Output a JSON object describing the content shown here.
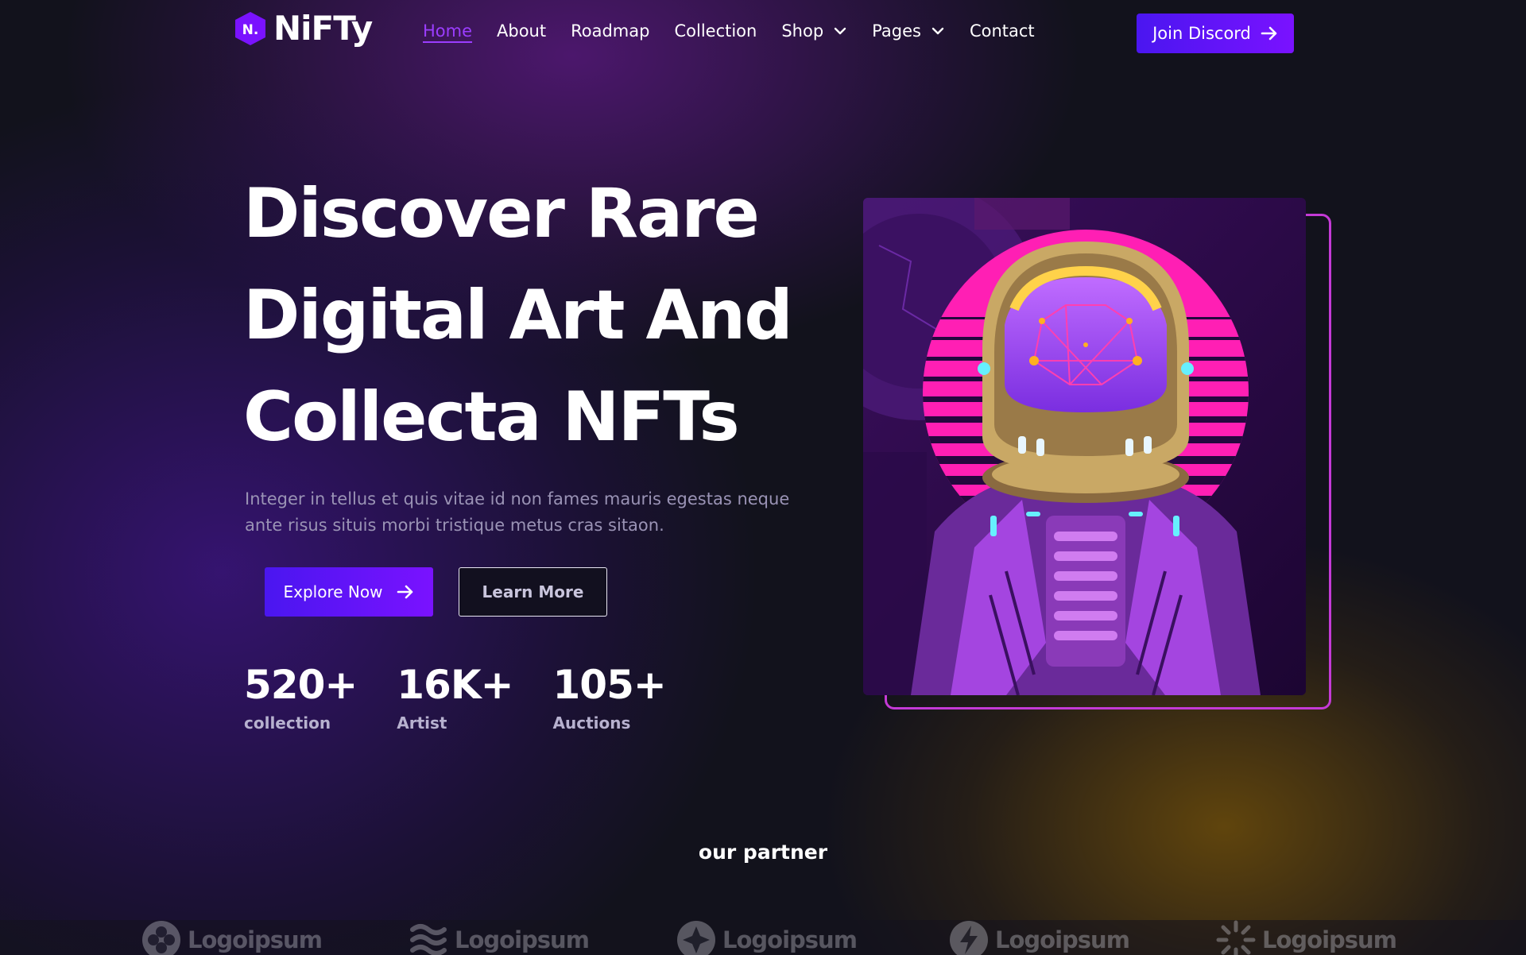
{
  "brand": {
    "logo_mark": "N.",
    "name": "NiFTy"
  },
  "nav": {
    "items": [
      {
        "label": "Home",
        "active": true
      },
      {
        "label": "About"
      },
      {
        "label": "Roadmap"
      },
      {
        "label": "Collection"
      },
      {
        "label": "Shop",
        "dropdown": true
      },
      {
        "label": "Pages",
        "dropdown": true
      },
      {
        "label": "Contact"
      }
    ],
    "cta_label": "Join Discord"
  },
  "hero": {
    "title_line1": "Discover Rare",
    "title_line2": "Digital Art And",
    "title_line3_prefix": "Collecta ",
    "title_highlight": "NFTs",
    "description": "Integer in tellus et quis vitae id non fames mauris egestas neque ante risus situis morbi tristique metus cras sitaon.",
    "primary_button": "Explore Now",
    "secondary_button": "Learn More"
  },
  "stats": [
    {
      "value": "520+",
      "label": "collection"
    },
    {
      "value": "16K+",
      "label": "Artist"
    },
    {
      "value": "105+",
      "label": "Auctions"
    }
  ],
  "partners": {
    "title": "our partner",
    "logos": [
      {
        "name": "Logoipsum",
        "icon": "clover-icon"
      },
      {
        "name": "Logoipsum",
        "icon": "waves-icon"
      },
      {
        "name": "Logoipsum",
        "icon": "star-badge-icon"
      },
      {
        "name": "Logoipsum",
        "icon": "bolt-icon"
      },
      {
        "name": "Logoipsum",
        "icon": "sunburst-icon"
      }
    ]
  },
  "colors": {
    "accent": "#6a14ff",
    "highlight": "#f5a623",
    "frame": "#c43ad6",
    "background": "#12121c"
  }
}
